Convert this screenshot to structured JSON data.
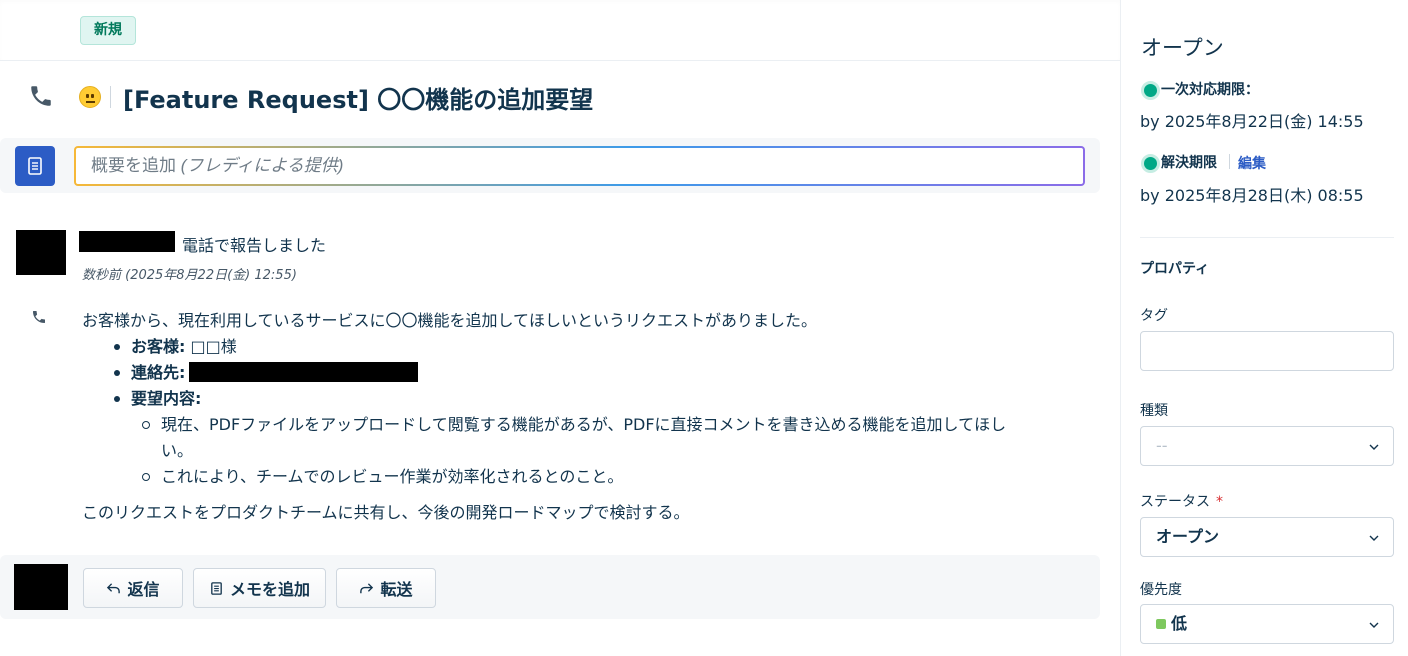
{
  "header": {
    "badge": "新規"
  },
  "ticket": {
    "title": "[Feature Request] 〇〇機能の追加要望"
  },
  "summary": {
    "placeholder": "概要を追加",
    "placeholder_hint": "(フレディによる提供)"
  },
  "conversation": {
    "reported_text": "電話で報告しました",
    "timestamp": "数秒前 (2025年8月22日(金) 12:55)",
    "intro": "お客様から、現在利用しているサービスに〇〇機能を追加してほしいというリクエストがありました。",
    "customer_label": "お客様:",
    "customer_value": "□□様",
    "contact_label": "連絡先:",
    "request_label": "要望内容:",
    "sub_items": [
      "現在、PDFファイルをアップロードして閲覧する機能があるが、PDFに直接コメントを書き込める機能を追加してほしい。",
      "これにより、チームでのレビュー作業が効率化されるとのこと。"
    ],
    "closing": "このリクエストをプロダクトチームに共有し、今後の開発ロードマップで検討する。"
  },
  "reply_bar": {
    "reply_label": "返信",
    "note_label": "メモを追加",
    "forward_label": "転送"
  },
  "sidebar": {
    "status_title": "オープン",
    "first_response_label": "一次対応期限：",
    "first_response_value": "by 2025年8月22日(金) 14:55",
    "resolution_label": "解決期限",
    "edit_label": "編集",
    "resolution_value": "by 2025年8月28日(木) 08:55",
    "properties_heading": "プロパティ",
    "tags_label": "タグ",
    "type_label": "種類",
    "type_value": "--",
    "status_label": "ステータス",
    "status_required": "*",
    "status_value": "オープン",
    "priority_label": "優先度",
    "priority_value": "低"
  },
  "colors": {
    "accent": "#2c5cc5",
    "sla_green": "#00a886",
    "priority_low": "#7ec85e",
    "text": "#12344d"
  }
}
